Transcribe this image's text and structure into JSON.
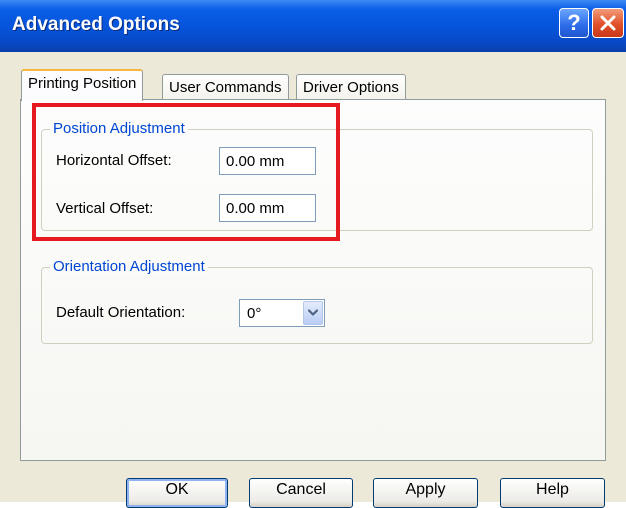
{
  "window": {
    "title": "Advanced Options"
  },
  "titlebar": {
    "help_label": "?"
  },
  "tabs": [
    {
      "label": "Printing Position",
      "active": true
    },
    {
      "label": "User Commands",
      "active": false
    },
    {
      "label": "Driver Options",
      "active": false
    }
  ],
  "position_adjustment": {
    "title": "Position Adjustment",
    "horizontal_label": "Horizontal Offset:",
    "horizontal_value": "0.00 mm",
    "vertical_label": "Vertical Offset:",
    "vertical_value": "0.00 mm"
  },
  "orientation_adjustment": {
    "title": "Orientation Adjustment",
    "default_label": "Default Orientation:",
    "default_value": "0°"
  },
  "buttons": {
    "ok": "OK",
    "cancel": "Cancel",
    "apply": "Apply",
    "help": "Help"
  },
  "icons": {
    "help": "question-mark-icon",
    "close": "close-x-icon",
    "dropdown": "chevron-down-icon"
  },
  "colors": {
    "titlebar": "#0553d8",
    "group_title": "#0046d5",
    "highlight": "#e5191f",
    "active_tab_accent": "#f5b642"
  }
}
